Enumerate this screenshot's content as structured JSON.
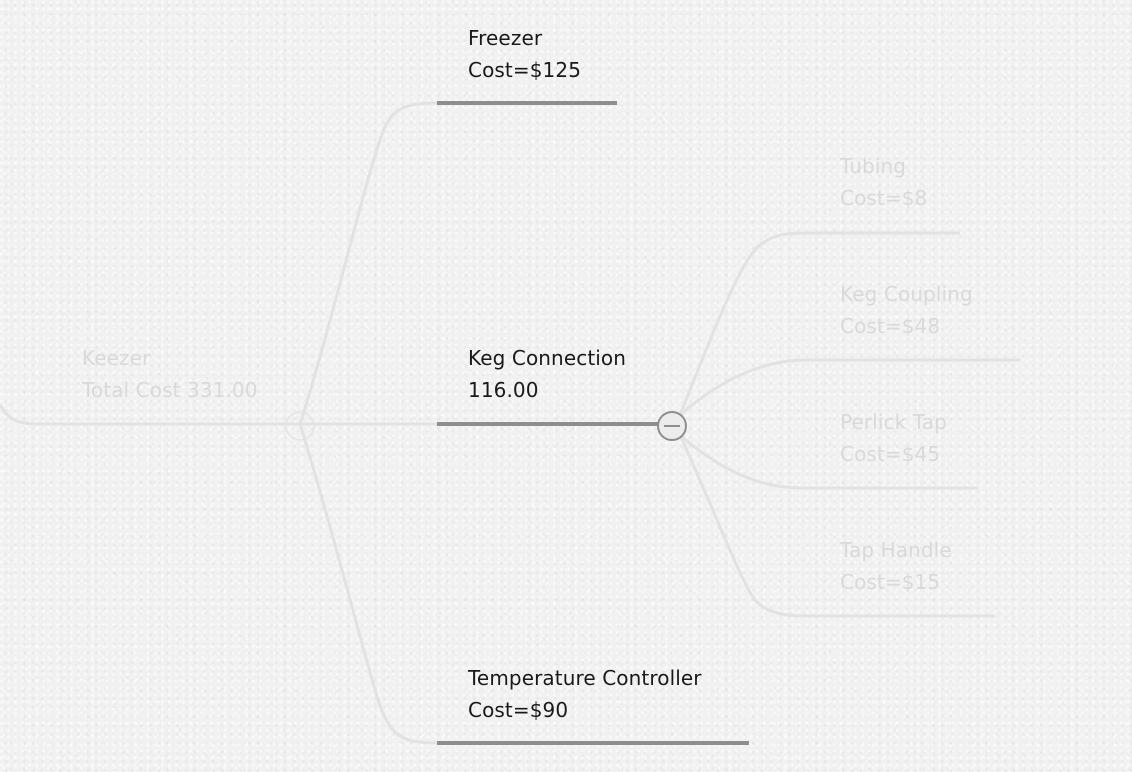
{
  "mindmap": {
    "root": {
      "title": "Keezer",
      "value": "Total Cost 331.00"
    },
    "branches": [
      {
        "title": "Freezer",
        "value": "Cost=$125"
      },
      {
        "title": "Keg Connection",
        "value": "116.00",
        "collapse_icon": "minus-circle-icon"
      },
      {
        "title": "Temperature Controller",
        "value": "Cost=$90"
      }
    ],
    "keg_connection_children": [
      {
        "title": "Tubing",
        "value": "Cost=$8"
      },
      {
        "title": "Keg Coupling",
        "value": "Cost=$48"
      },
      {
        "title": "Perlick Tap",
        "value": "Cost=$45"
      },
      {
        "title": "Tap Handle",
        "value": "Cost=$15"
      }
    ],
    "colors": {
      "active_text": "#1a1a1a",
      "active_line": "#8e8e8e",
      "faded_text": "#d9d9d9",
      "faded_line": "#e2e2e2",
      "background": "#f1f1f1"
    }
  }
}
